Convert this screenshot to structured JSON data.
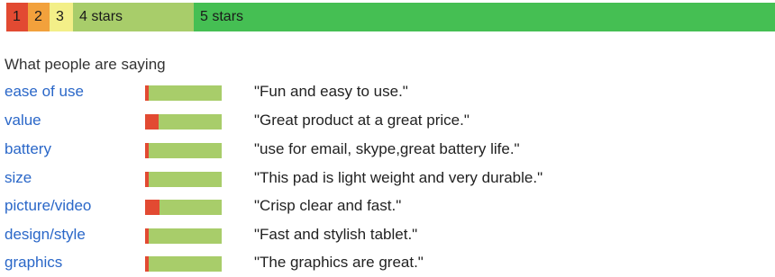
{
  "colors": {
    "star_1": "#e24a32",
    "star_2": "#f2a13c",
    "star_3": "#f3ef88",
    "star_4": "#a8cd6a",
    "star_5": "#45bf53",
    "sentiment_negative": "#e24a32",
    "sentiment_positive": "#a8cd6a",
    "link": "#2a67c8"
  },
  "rating_distribution": [
    {
      "label": "1"
    },
    {
      "label": "2"
    },
    {
      "label": "3"
    },
    {
      "label": "4 stars"
    },
    {
      "label": "5 stars"
    }
  ],
  "section_title": "What people are saying",
  "aspects": [
    {
      "name": "ease of use",
      "quote": "\"Fun and easy to use.\"",
      "negative_share": 0.05
    },
    {
      "name": "value",
      "quote": "\"Great product at a great price.\"",
      "negative_share": 0.18
    },
    {
      "name": "battery",
      "quote": "\"use for email, skype,great battery life.\"",
      "negative_share": 0.05
    },
    {
      "name": "size",
      "quote": "\"This pad is light weight and very durable.\"",
      "negative_share": 0.05
    },
    {
      "name": "picture/video",
      "quote": "\"Crisp clear and fast.\"",
      "negative_share": 0.19
    },
    {
      "name": "design/style",
      "quote": "\"Fast and stylish tablet.\"",
      "negative_share": 0.05
    },
    {
      "name": "graphics",
      "quote": "\"The graphics are great.\"",
      "negative_share": 0.05
    }
  ]
}
